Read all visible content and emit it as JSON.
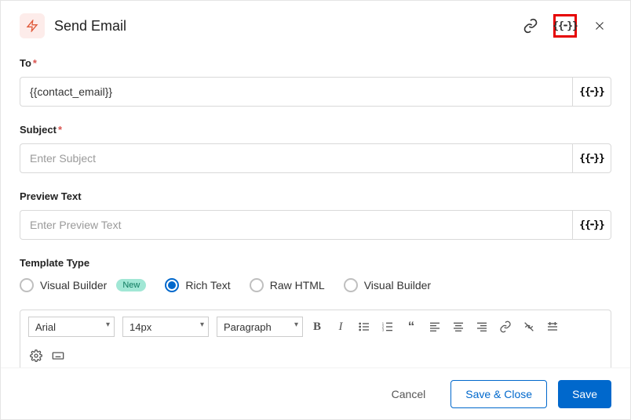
{
  "header": {
    "title": "Send Email"
  },
  "fields": {
    "to": {
      "label": "To",
      "value": "{{contact_email}}"
    },
    "subject": {
      "label": "Subject",
      "placeholder": "Enter Subject"
    },
    "preview": {
      "label": "Preview Text",
      "placeholder": "Enter Preview Text"
    },
    "template": {
      "label": "Template Type",
      "options": [
        "Visual Builder",
        "Rich Text",
        "Raw HTML",
        "Visual Builder"
      ],
      "new_badge": "New",
      "selected_index": 1
    }
  },
  "editor": {
    "font": "Arial",
    "size": "14px",
    "block": "Paragraph"
  },
  "footer": {
    "cancel": "Cancel",
    "save_close": "Save & Close",
    "save": "Save"
  }
}
